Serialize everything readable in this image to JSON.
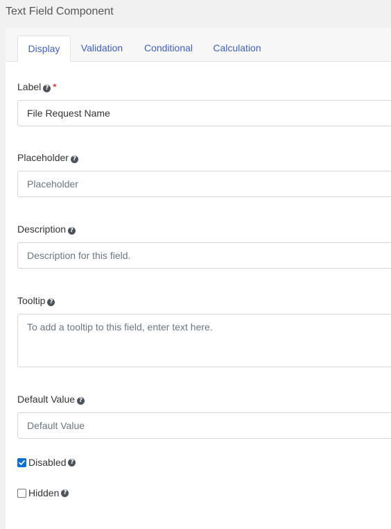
{
  "window": {
    "title": "Text Field Component"
  },
  "tabs": [
    {
      "label": "Display",
      "active": true
    },
    {
      "label": "Validation",
      "active": false
    },
    {
      "label": "Conditional",
      "active": false
    },
    {
      "label": "Calculation",
      "active": false
    }
  ],
  "fields": {
    "label": {
      "label": "Label",
      "required_mark": "*",
      "value": "File Request Name"
    },
    "placeholder": {
      "label": "Placeholder",
      "placeholder": "Placeholder"
    },
    "description": {
      "label": "Description",
      "placeholder": "Description for this field."
    },
    "tooltip": {
      "label": "Tooltip",
      "placeholder": "To add a tooltip to this field, enter text here."
    },
    "default_value": {
      "label": "Default Value",
      "placeholder": "Default Value"
    }
  },
  "checkboxes": {
    "disabled": {
      "label": "Disabled",
      "checked": true
    },
    "hidden": {
      "label": "Hidden",
      "checked": false
    }
  },
  "icons": {
    "help": "question-circle-icon",
    "check": "check-icon"
  },
  "colors": {
    "tab_text": "#3f5fc4",
    "required": "#cc0000",
    "checkbox_checked": "#0b6fd6"
  }
}
